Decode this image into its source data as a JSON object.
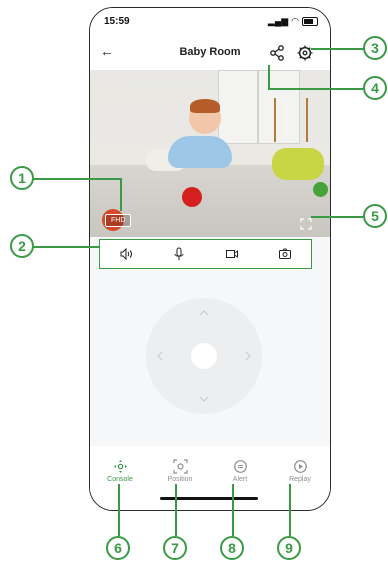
{
  "status": {
    "time": "15:59"
  },
  "nav": {
    "title": "Baby Room",
    "back_icon": "back-arrow-icon",
    "share_icon": "share-icon",
    "settings_icon": "gear-icon"
  },
  "video": {
    "quality_label": "FHD",
    "fullscreen_icon": "fullscreen-icon"
  },
  "controls": [
    {
      "name": "speaker-icon"
    },
    {
      "name": "microphone-icon"
    },
    {
      "name": "record-video-icon"
    },
    {
      "name": "snapshot-camera-icon"
    }
  ],
  "tabs": [
    {
      "label": "Console",
      "icon": "dpad-icon",
      "active": true
    },
    {
      "label": "Position",
      "icon": "position-icon",
      "active": false
    },
    {
      "label": "Alert",
      "icon": "alert-icon",
      "active": false
    },
    {
      "label": "Replay",
      "icon": "replay-icon",
      "active": false
    }
  ],
  "callouts": {
    "c1": "1",
    "c2": "2",
    "c3": "3",
    "c4": "4",
    "c5": "5",
    "c6": "6",
    "c7": "7",
    "c8": "8",
    "c9": "9"
  },
  "accent_color": "#3a9a46"
}
